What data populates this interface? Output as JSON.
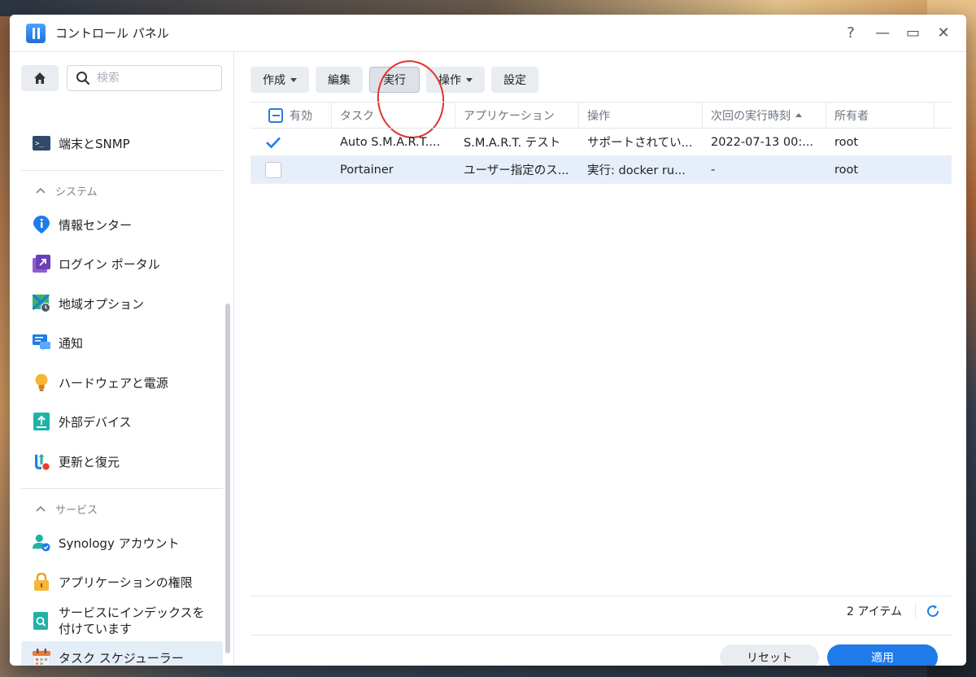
{
  "window": {
    "title": "コントロール パネル",
    "controls": {
      "help": "?",
      "minimize": "—",
      "maximize": "▭",
      "close": "✕"
    }
  },
  "sidebar": {
    "search_placeholder": "検索",
    "items_top": [
      {
        "label": "端末とSNMP",
        "icon": "terminal-icon"
      }
    ],
    "sections": [
      {
        "title": "システム",
        "items": [
          {
            "label": "情報センター",
            "icon": "info-icon"
          },
          {
            "label": "ログイン ポータル",
            "icon": "login-portal-icon"
          },
          {
            "label": "地域オプション",
            "icon": "region-icon"
          },
          {
            "label": "通知",
            "icon": "notification-icon"
          },
          {
            "label": "ハードウェアと電源",
            "icon": "lightbulb-icon"
          },
          {
            "label": "外部デバイス",
            "icon": "external-device-icon"
          },
          {
            "label": "更新と復元",
            "icon": "update-restore-icon"
          }
        ]
      },
      {
        "title": "サービス",
        "items": [
          {
            "label": "Synology アカウント",
            "icon": "account-icon"
          },
          {
            "label": "アプリケーションの権限",
            "icon": "lock-icon"
          },
          {
            "label": "サービスにインデックスを付けています",
            "label_line1": "サービスにインデックスを",
            "label_line2": "付けています",
            "icon": "indexing-icon"
          },
          {
            "label": "タスク スケジューラー",
            "icon": "calendar-icon",
            "active": true
          }
        ]
      }
    ]
  },
  "toolbar": {
    "create": "作成",
    "edit": "編集",
    "run": "実行",
    "action": "操作",
    "settings": "設定"
  },
  "grid": {
    "columns": [
      "有効",
      "タスク",
      "アプリケーション",
      "操作",
      "次回の実行時刻",
      "所有者"
    ],
    "rows": [
      {
        "enabled": true,
        "task": "Auto S.M.A.R.T....",
        "app": "S.M.A.R.T. テスト",
        "op": "サポートされてい...",
        "next": "2022-07-13 00:...",
        "owner": "root"
      },
      {
        "enabled": false,
        "task": "Portainer",
        "app": "ユーザー指定のス...",
        "op": "実行: docker ru...",
        "next": "-",
        "owner": "root"
      }
    ]
  },
  "footer": {
    "count": "2 アイテム",
    "reset": "リセット",
    "apply": "適用"
  },
  "colors": {
    "accent": "#1f7bea",
    "annotation": "#e0332b",
    "selected_row": "#e5eef9"
  }
}
